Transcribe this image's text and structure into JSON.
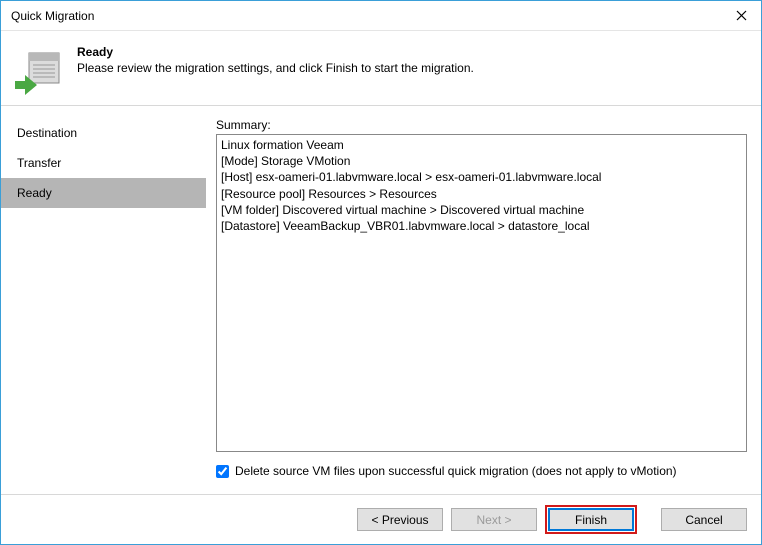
{
  "window": {
    "title": "Quick Migration"
  },
  "header": {
    "title": "Ready",
    "subtitle": "Please review the migration settings, and click Finish to start the migration."
  },
  "sidebar": {
    "items": [
      {
        "label": "Destination",
        "active": false
      },
      {
        "label": "Transfer",
        "active": false
      },
      {
        "label": "Ready",
        "active": true
      }
    ]
  },
  "main": {
    "summary_label": "Summary:",
    "summary_lines": [
      "Linux formation Veeam",
      "[Mode] Storage VMotion",
      "[Host] esx-oameri-01.labvmware.local > esx-oameri-01.labvmware.local",
      "[Resource pool] Resources > Resources",
      "[VM folder] Discovered virtual machine > Discovered virtual machine",
      "[Datastore] VeeamBackup_VBR01.labvmware.local > datastore_local"
    ],
    "checkbox_label": "Delete source VM files upon successful quick migration (does not apply to vMotion)",
    "checkbox_checked": true
  },
  "footer": {
    "previous": "< Previous",
    "next": "Next >",
    "finish": "Finish",
    "cancel": "Cancel"
  },
  "colors": {
    "border_blue": "#3a9fd8",
    "highlight_red": "#d11a1a",
    "sidebar_active": "#b5b5b5"
  }
}
